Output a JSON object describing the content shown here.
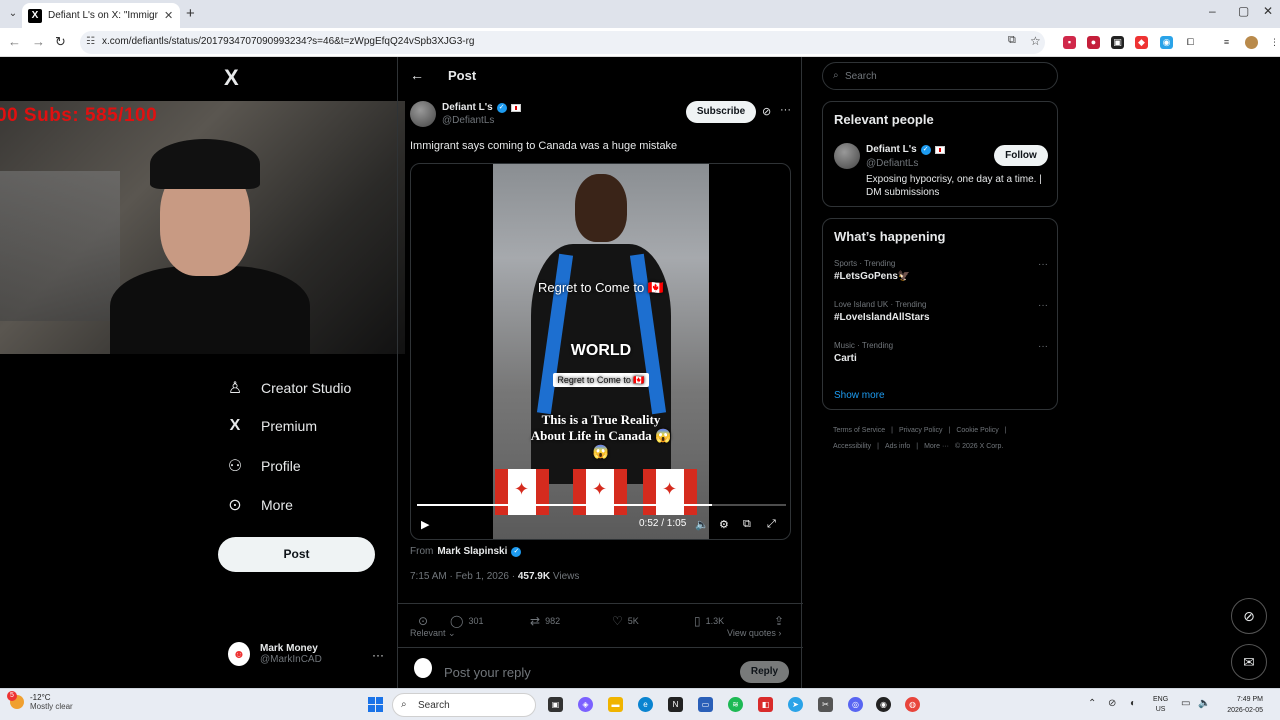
{
  "browser": {
    "tab_title": "Defiant L's on X: \"Immigrant sa",
    "tab_favicon": "X",
    "url": "x.com/defiantls/status/2017934707090993234?s=46&t=zWpgEfqQ24vSpb3XJG3-rg"
  },
  "overlay": {
    "subs_text": "00  Subs: 585/100"
  },
  "nav": {
    "logo": "X",
    "items": [
      {
        "label": "Creator Studio",
        "icon": "creator-studio-icon"
      },
      {
        "label": "Premium",
        "icon": "x-premium-icon"
      },
      {
        "label": "Profile",
        "icon": "person-icon"
      },
      {
        "label": "More",
        "icon": "more-circle-icon"
      }
    ],
    "post_button": "Post",
    "account_name": "Mark Money",
    "account_handle": "@MarkInCAD",
    "account_more": "···"
  },
  "post": {
    "header_title": "Post",
    "author_name": "Defiant L's",
    "author_handle": "@DefiantLs",
    "subscribe_label": "Subscribe",
    "text": "Immigrant says coming to Canada was a huge mistake",
    "video": {
      "caption1": "Regret to Come to 🇨🇦",
      "caption2": "WORLD",
      "caption3": "Regret to Come to 🇨🇦",
      "caption4_line1": "This is a True Reality",
      "caption4_line2": "About Life in Canada 😱",
      "caption4_line3": "😱",
      "time": "0:52 / 1:05",
      "progress_fraction": 0.8
    },
    "from_label": "From",
    "from_name": "Mark Slapinski",
    "timestamp": "7:15 AM · Feb 1, 2026 · ",
    "views_count": "457.9K",
    "views_label": " Views",
    "stats": {
      "replies": "301",
      "reposts": "982",
      "likes": "5K",
      "bookmarks": "1.3K"
    },
    "sort_label": "Relevant ⌄",
    "view_quotes": "View quotes ›",
    "reply_placeholder": "Post your reply",
    "reply_button": "Reply"
  },
  "sidebar": {
    "search_placeholder": "Search",
    "relevant_title": "Relevant people",
    "person_name": "Defiant L's",
    "person_handle": "@DefiantLs",
    "follow_label": "Follow",
    "person_bio": "Exposing hypocrisy, one day at a time. | DM submissions",
    "happening_title": "What’s happening",
    "trends": [
      {
        "category": "Sports · Trending",
        "name": "#LetsGoPens🦅"
      },
      {
        "category": "Love Island UK · Trending",
        "name": "#LoveIslandAllStars"
      },
      {
        "category": "Music · Trending",
        "name": "Carti"
      }
    ],
    "show_more": "Show more",
    "footer": [
      "Terms of Service",
      "|",
      "Privacy Policy",
      "|",
      "Cookie Policy",
      "|",
      "Accessibility",
      "|",
      "Ads info",
      "|",
      "More ···",
      "© 2026 X Corp."
    ]
  },
  "taskbar": {
    "weather_temp": "-12°C",
    "weather_desc": "Mostly clear",
    "weather_badge": "5",
    "search_label": "Search",
    "lang_line1": "ENG",
    "lang_line2": "US",
    "time": "7:49 PM",
    "date": "2026-02-05"
  },
  "colors": {
    "accent": "#1d9bf0",
    "background": "#000000",
    "border": "#2f3336",
    "muted_text": "#71767b"
  }
}
